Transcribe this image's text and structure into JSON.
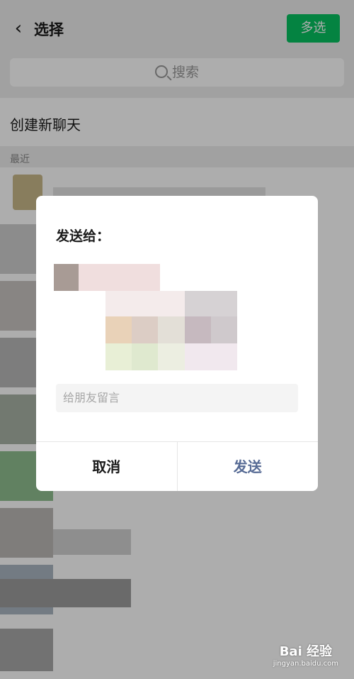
{
  "header": {
    "back_icon": "chevron-left-icon",
    "title": "选择",
    "multi_select_label": "多选",
    "accent": "#07c160"
  },
  "search": {
    "placeholder": "搜索"
  },
  "list": {
    "new_chat_label": "创建新聊天",
    "recent_label": "最近"
  },
  "dialog": {
    "title": "发送给：",
    "message_placeholder": "给朋友留言",
    "cancel_label": "取消",
    "send_label": "发送",
    "send_color": "#576b95"
  },
  "watermark": {
    "brand": "Bai 经验",
    "url": "jingyan.baidu.com"
  }
}
